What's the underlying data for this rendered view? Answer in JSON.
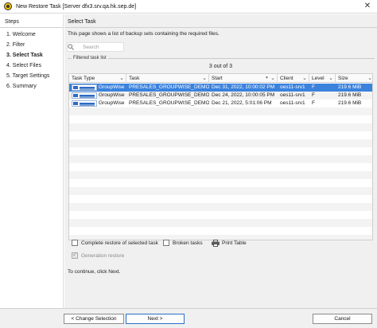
{
  "window": {
    "title": "New Restore Task [Server dfx3.srv.qa.hk.sep.de]",
    "close_glyph": "✕"
  },
  "sidebar": {
    "heading": "Steps",
    "steps": [
      {
        "label": "1. Welcome",
        "active": false
      },
      {
        "label": "2. Filter",
        "active": false
      },
      {
        "label": "3. Select Task",
        "active": true
      },
      {
        "label": "4. Select Files",
        "active": false
      },
      {
        "label": "5. Target Settings",
        "active": false
      },
      {
        "label": "6. Summary",
        "active": false
      }
    ]
  },
  "main": {
    "title": "Select Task",
    "description": "This page shows a list of backup sets containing the required files.",
    "search": {
      "placeholder": "Search",
      "value": ""
    },
    "filtered_label": "Filtered task list",
    "count_label": "3 out of 3"
  },
  "grid": {
    "columns": [
      "Task Type",
      "Task",
      "Start",
      "Client",
      "Level",
      "Size"
    ],
    "rows": [
      {
        "type": "GroupWise",
        "task": "PRESALES_GROUPWISE_DEMO",
        "start": "Dec 31, 2022, 10:00:02 PM",
        "client": "oes11-srv1",
        "level": "F",
        "size": "219.6 MiB",
        "selected": true
      },
      {
        "type": "GroupWise",
        "task": "PRESALES_GROUPWISE_DEMO",
        "start": "Dec 24, 2022, 10:00:05 PM",
        "client": "oes11-srv1",
        "level": "F",
        "size": "219.6 MiB",
        "selected": false
      },
      {
        "type": "GroupWise",
        "task": "PRESALES_GROUPWISE_DEMO",
        "start": "Dec 21, 2022, 5:01:06 PM",
        "client": "oes11-srv1",
        "level": "F",
        "size": "219.6 MiB",
        "selected": false
      }
    ]
  },
  "options": {
    "complete_restore": "Complete restore of selected task",
    "broken_tasks": "Broken tasks",
    "print_table": "Print Table",
    "generation_restore": "Generation restore"
  },
  "continue_text": "To continue, click Next.",
  "footer": {
    "back": "< Change Selection",
    "next": "Next >",
    "cancel": "Cancel"
  },
  "colors": {
    "selection": "#3b82dc",
    "accent": "#2a6fc9",
    "app_icon": "#f2c200"
  },
  "icons": {
    "app": "sesam-logo-icon",
    "search": "search-icon",
    "task_type": "groupwise-icon",
    "print": "printer-icon"
  }
}
